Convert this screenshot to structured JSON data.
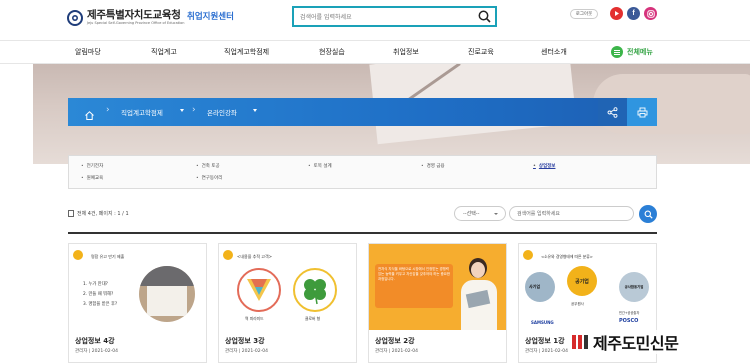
{
  "header": {
    "org_name": "제주특별자치도교육청",
    "org_sub": "Jeju Special Self-Governing Province Office of Education",
    "site_name": "취업지원센터",
    "search_placeholder": "검색어를 입력하세요",
    "login_label": "로그아웃",
    "social": [
      {
        "name": "youtube-icon",
        "glyph": "▶",
        "color": "#e3302f"
      },
      {
        "name": "facebook-icon",
        "glyph": "f",
        "color": "#3b5998"
      },
      {
        "name": "instagram-icon",
        "glyph": "◎",
        "color": "#d6337c"
      }
    ]
  },
  "nav": {
    "items": [
      "알림마당",
      "직업계고",
      "직업계고학점제",
      "현장실습",
      "취업정보",
      "진로교육",
      "센터소개"
    ],
    "all_menu_label": "전체메뉴"
  },
  "breadcrumb": {
    "items": [
      "직업계고학점제",
      "온라인강좌"
    ],
    "share_icon": "share-icon",
    "print_icon": "print-icon"
  },
  "categories": {
    "row1": [
      "전기전자",
      "건축 토공",
      "토목 설계",
      "경영 금융",
      "상업정보"
    ],
    "row2": [
      "원예교육",
      "연구동아리"
    ],
    "active": "상업정보"
  },
  "listing": {
    "count_text": "전체 4건, 페이지 : 1 / 1",
    "select_label": "--선택--",
    "keyword_placeholder": "검색어를 입력하세요"
  },
  "cards": [
    {
      "title": "상업정보 4강",
      "date": "관리자 | 2021-02-04"
    },
    {
      "title": "상업정보 3강",
      "date": "관리자 | 2021-02-04"
    },
    {
      "title": "상업정보 2강",
      "date": "관리자 | 2021-02-04"
    },
    {
      "title": "상업정보 1강",
      "date": "관리자 | 2021-02-04"
    }
  ],
  "card_thumbs": {
    "c1": {
      "heading": "명함 유고 만기 제출",
      "list": [
        "1. 누가 만대?",
        "2. 만들 때 뭐해?",
        "3. 명함을 받은 후?"
      ]
    },
    "c2": {
      "heading": "<내용을 추적 고객>",
      "left_label": "역 피라미드",
      "right_label": "클로버 형"
    },
    "c3": {
      "lines": "전자식 지식을 바탕으로 시장에서 인정받는 경쟁력 있는 능력을 키우고 자신감을 갖추어야 하는 중요한 과정입니다."
    },
    "c4": {
      "heading": "<소유와 경영형태에 따른 분류>",
      "center": "공기업",
      "left": "사기업",
      "right": "공사합동기업",
      "small1": "공무원사",
      "small2": "민간+공공출자",
      "brands": [
        "SAMSUNG",
        "POSCO"
      ]
    }
  },
  "watermark": "제주도민신문"
}
